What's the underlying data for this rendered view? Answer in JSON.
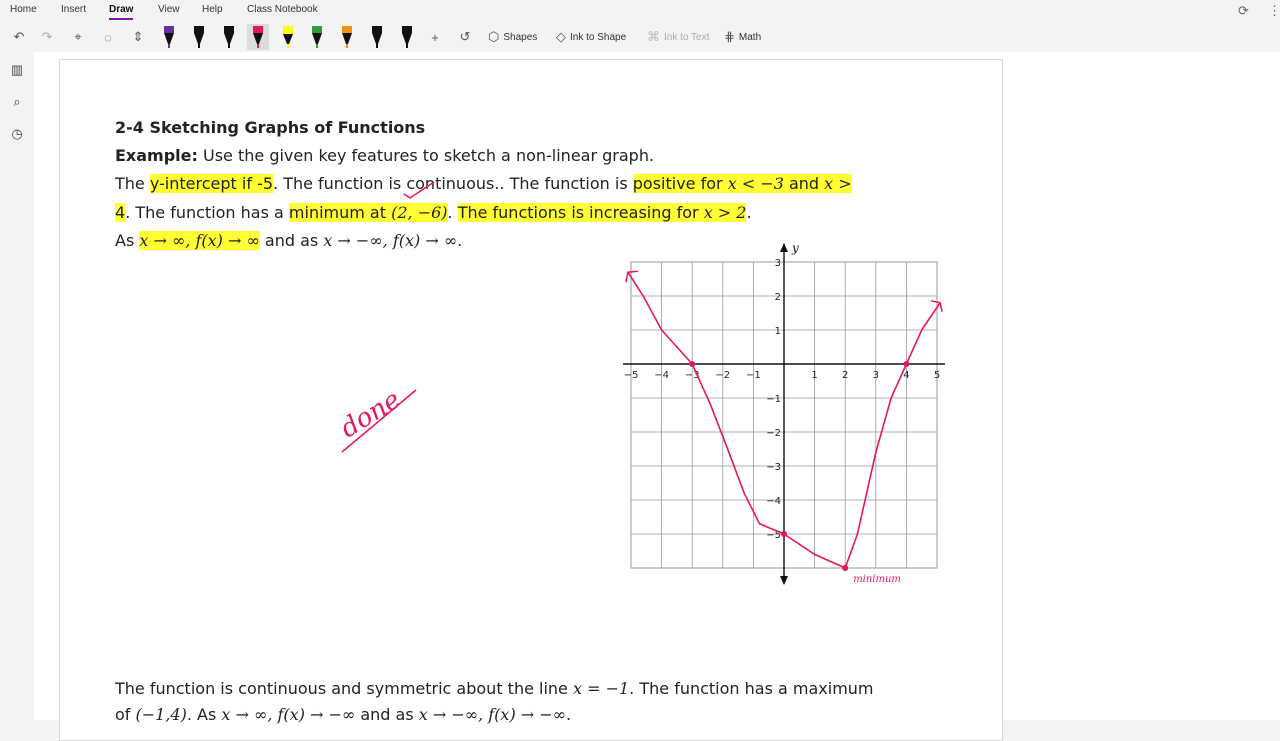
{
  "menu": {
    "items": [
      "Home",
      "Insert",
      "Draw",
      "View",
      "Help",
      "Class Notebook"
    ],
    "active": "Draw"
  },
  "toolbar": {
    "shapes_label": "Shapes",
    "ink_to_shape_label": "Ink to Shape",
    "ink_to_text_label": "Ink to Text",
    "math_label": "Math",
    "pens": [
      {
        "name": "pen-1",
        "color": "#6b2fa0"
      },
      {
        "name": "pen-2",
        "color": "#111111"
      },
      {
        "name": "pen-3",
        "color": "#111111"
      },
      {
        "name": "pen-4",
        "color": "#e8175d"
      },
      {
        "name": "highlighter-yellow",
        "color": "#ffff00"
      },
      {
        "name": "pen-green",
        "color": "#2e9e3a"
      },
      {
        "name": "pen-orange",
        "color": "#f29111"
      },
      {
        "name": "pen-6",
        "color": "#111111"
      },
      {
        "name": "pen-7",
        "color": "#111111"
      }
    ]
  },
  "note": {
    "title": "2-4 Sketching Graphs of Functions",
    "example_label": "Example:",
    "example_text": " Use the given key features to sketch a non-linear graph.",
    "l2_a": "The ",
    "l2_b": "y-intercept if -5",
    "l2_c": ". The function is continuous.. The function is ",
    "l2_d": "positive for ",
    "l2_e": "x < −3",
    "l2_f": " and ",
    "l2_g": "x >",
    "l3_a": "4",
    "l3_b": ". The function has a ",
    "l3_c": "minimum at ",
    "l3_d": "(2, −6)",
    "l3_e": ". ",
    "l3_f": "The functions is increasing for ",
    "l3_g": "x > 2",
    "l3_h": ".",
    "l4_a": "As ",
    "l4_b": "x → ∞,  f(x) → ∞",
    "l4_c": " and as ",
    "l4_d": "x → −∞, f(x) → ∞",
    "l4_e": ".",
    "l5_a": "The function is continuous and symmetric about the line ",
    "l5_b": "x = −1",
    "l5_c": ". The function has a maximum",
    "l6_a": "of ",
    "l6_b": "(−1,4)",
    "l6_c": ". As ",
    "l6_d": "x → ∞,  f(x) → −∞",
    "l6_e": " and as ",
    "l6_f": "x → −∞, f(x) → −∞",
    "l6_g": ".",
    "ink_done": "done",
    "ink_minimum": "minimum"
  },
  "graph": {
    "y_axis_label": "y",
    "x_ticks": [
      "−5",
      "−4",
      "−3",
      "−2",
      "−1",
      "1",
      "2",
      "3",
      "4",
      "5"
    ],
    "y_ticks": [
      "3",
      "2",
      "1",
      "−1",
      "−2",
      "−3",
      "−4",
      "−5"
    ],
    "ink_color": "#e8175d"
  }
}
